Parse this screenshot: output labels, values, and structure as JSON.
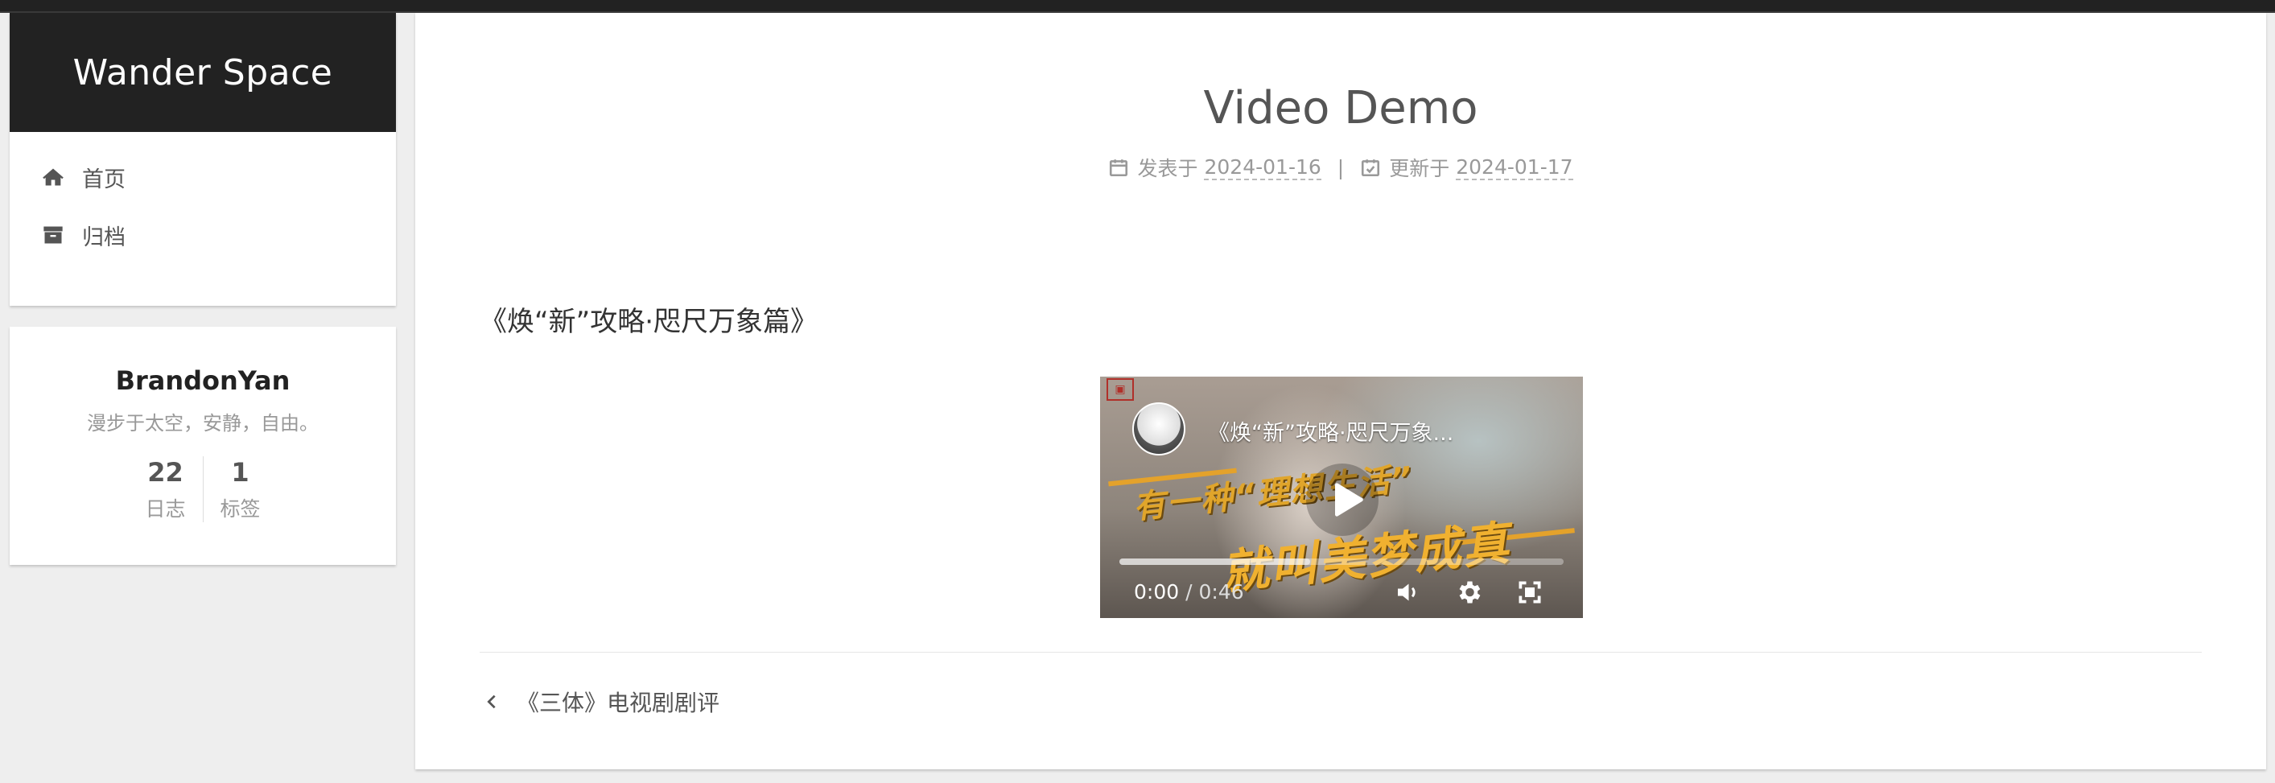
{
  "site": {
    "title": "Wander Space"
  },
  "menu": [
    {
      "label": "首页",
      "icon": "home-icon"
    },
    {
      "label": "归档",
      "icon": "archive-icon"
    }
  ],
  "author": {
    "name": "BrandonYan",
    "description": "漫步于太空，安静，自由。",
    "stats": [
      {
        "count": "22",
        "label": "日志"
      },
      {
        "count": "1",
        "label": "标签"
      }
    ]
  },
  "post": {
    "title": "Video Demo",
    "published_label": "发表于",
    "published_date": "2024-01-16",
    "separator": "|",
    "updated_label": "更新于",
    "updated_date": "2024-01-17",
    "subtitle": "《焕“新”攻略·咫尺万象篇》"
  },
  "video": {
    "title": "《焕“新”攻略·咫尺万象...",
    "overlay_line1": "有一种“理想生活”",
    "overlay_line2": "就叫美梦成真",
    "current_time": "0:00",
    "time_separator": " / ",
    "duration": "0:46",
    "buffered_fraction": 0.43
  },
  "navigation": {
    "prev_label": "《三体》电视剧剧评"
  },
  "colors": {
    "brand_background": "#222222",
    "page_background": "#eeeeee",
    "card_background": "#ffffff",
    "overlay_gold": "#f0b130"
  }
}
